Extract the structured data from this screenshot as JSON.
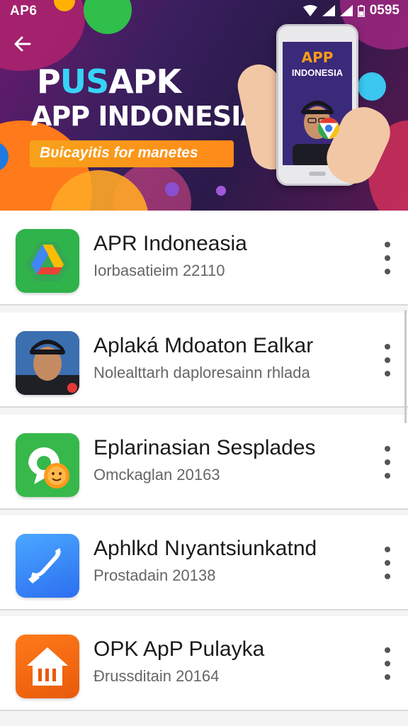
{
  "status_bar": {
    "left_label": "AP6",
    "time": "0595"
  },
  "banner": {
    "title_part1": "P",
    "title_accent": "US",
    "title_part2": "APK",
    "subtitle": "APP INDONESIA",
    "tagline": "Bυicayitis for manetes",
    "phone_screen_title": "APP",
    "phone_screen_subtitle": "INDONESIA"
  },
  "apps": [
    {
      "title": "APR Indoneasia",
      "subtitle": "Ιorbasatieim 22110",
      "icon": "drive-icon"
    },
    {
      "title": "Aplaká Mdoaton Ealkar",
      "subtitle": "Nolealttarh daploresainn rhlada",
      "icon": "avatar-photo-icon"
    },
    {
      "title": "Eplarinasian Sesplades",
      "subtitle": "Omckaglan 20163",
      "icon": "sun-mascot-icon"
    },
    {
      "title": "Aphlkd Nıyantsiunkatnd",
      "subtitle": "Prostadain 20138",
      "icon": "phone-handset-icon"
    },
    {
      "title": "OPK ApP Pulayka",
      "subtitle": "Đrussditain 20164",
      "icon": "house-icon"
    }
  ],
  "colors": {
    "banner_tag": "#f7a21a",
    "accent_cyan": "#37d4f5",
    "list_title": "#1a1a1a",
    "list_subtitle": "#666666"
  }
}
